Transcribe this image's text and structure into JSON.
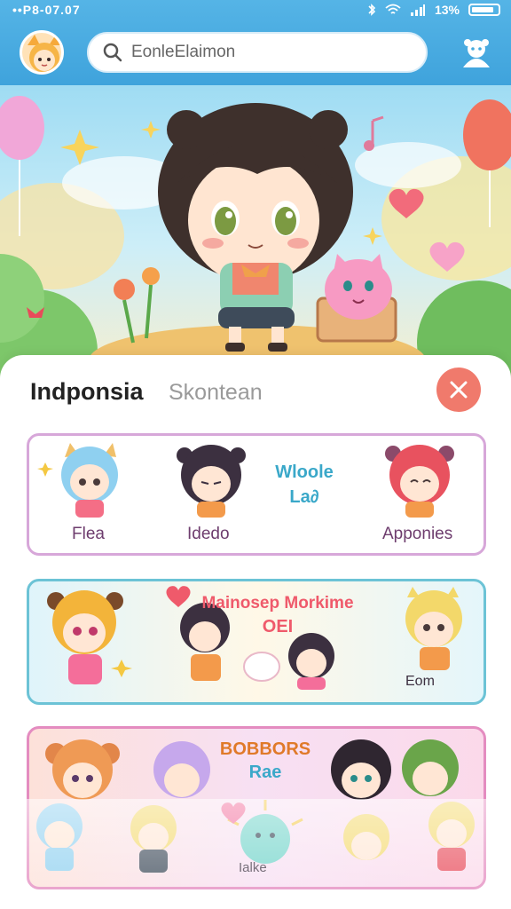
{
  "status_bar": {
    "left_text": "••P8-07.07",
    "battery_text": "13%"
  },
  "search": {
    "value": "EonleElaimon",
    "placeholder": "EonleElaimon"
  },
  "sheet": {
    "title": "Indponsia",
    "subtitle": "Skontean"
  },
  "card1": {
    "characters": [
      "Flea",
      "Idedo",
      "Apponies"
    ],
    "banner_line1": "Wloole",
    "banner_line2": "La∂"
  },
  "card2": {
    "banner_line1": "Mainosep Morkime",
    "banner_line2": "OEI",
    "corner_label": "Eom"
  },
  "card3": {
    "banner_line1": "BOBBORS",
    "banner_line2": "Rae",
    "bottom_label": "Ialke"
  },
  "colors": {
    "accent_blue": "#45aade",
    "close_red": "#f07a6c",
    "sheet_bg": "#ffffff"
  },
  "icons": [
    "avatar-icon",
    "search-icon",
    "profile-icon",
    "close-icon",
    "wifi-icon",
    "signal-icon",
    "battery-icon"
  ]
}
